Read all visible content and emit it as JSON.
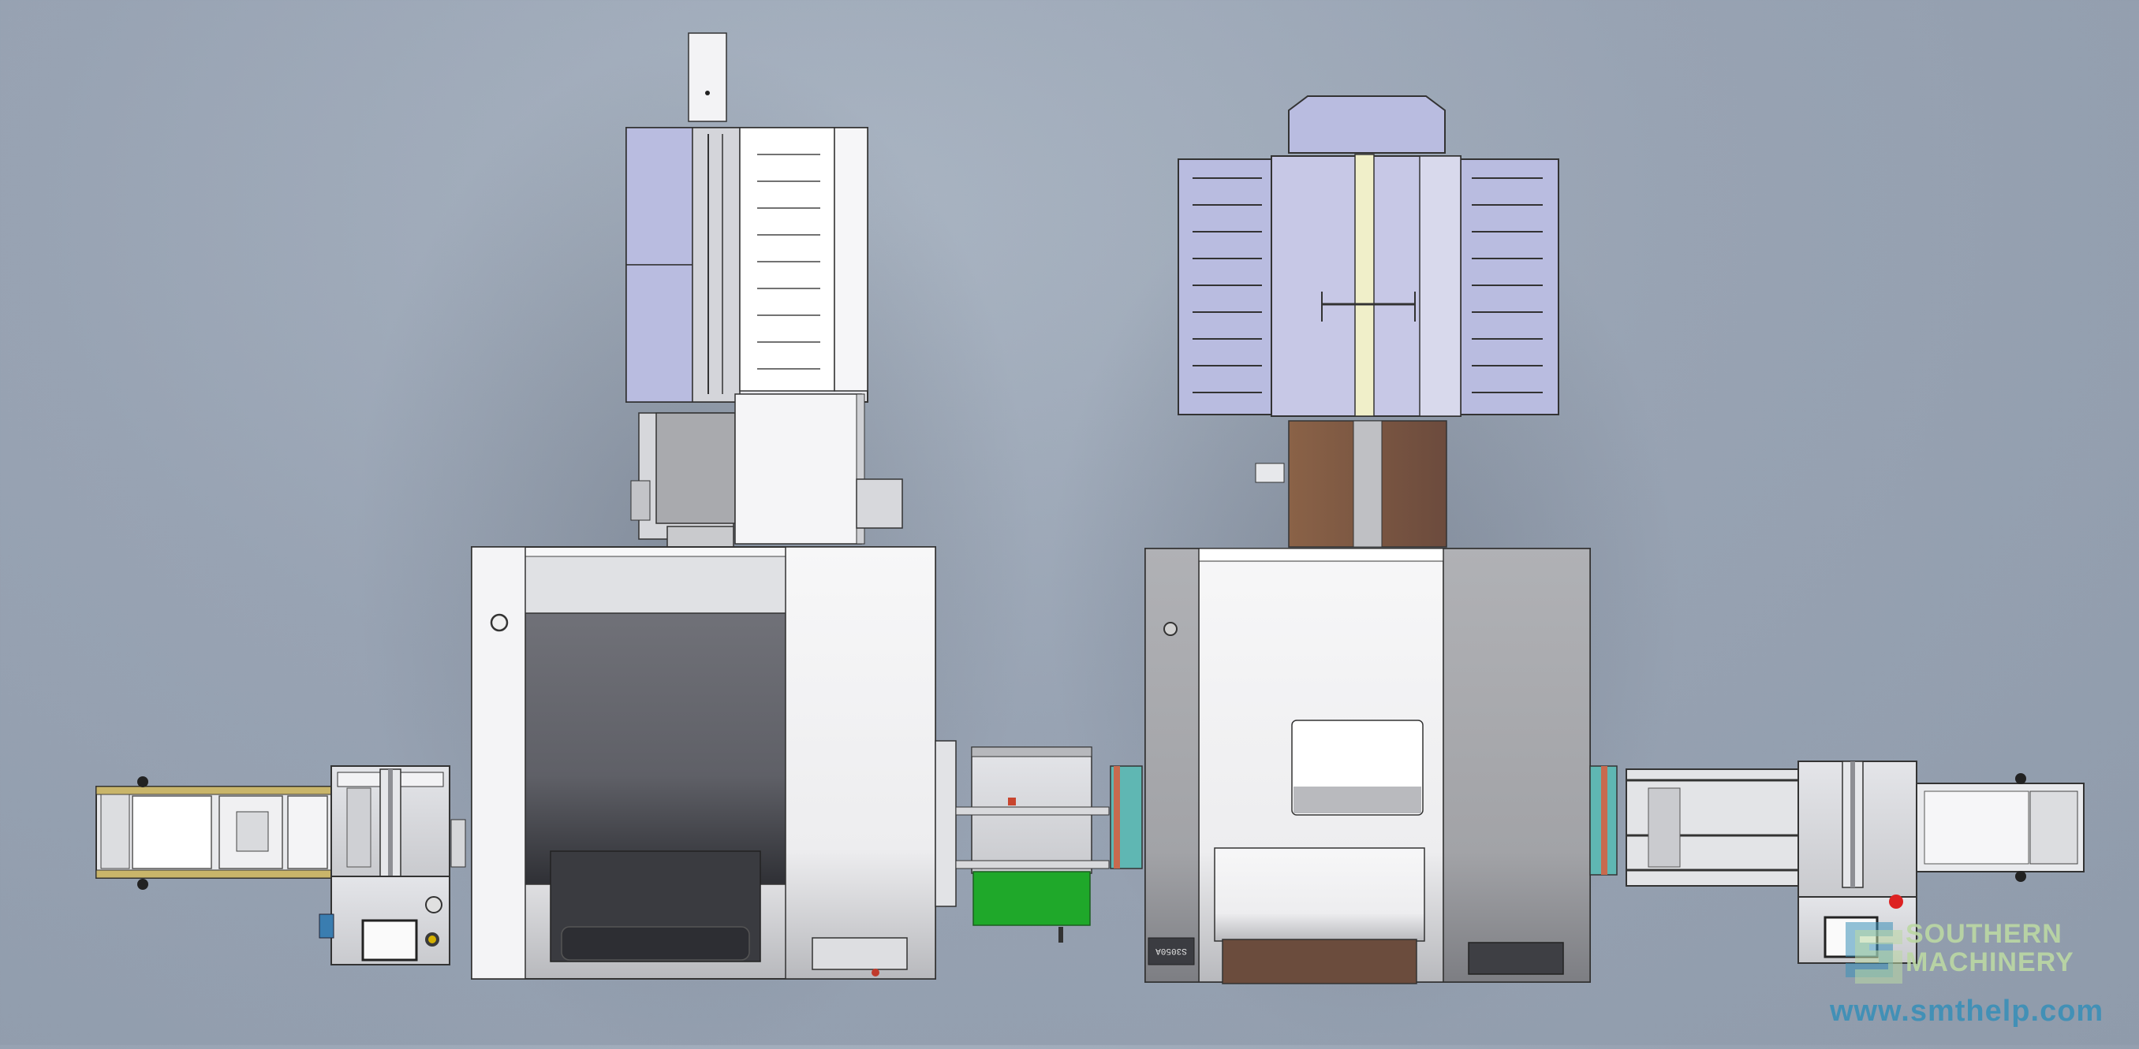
{
  "figure": {
    "model_plate_text": "S3050A"
  },
  "watermark": {
    "line1": "SOUTHERN",
    "line2": "MACHINERY",
    "url": "www.smthelp.com",
    "logo_icon": "sm-logo-icon"
  },
  "colors": {
    "background": "#98a3b3",
    "machine_white": "#f2f3f5",
    "machine_grey": "#a6a7ab",
    "magazine_lavender": "#b9bce0",
    "green_bin": "#1fa82a",
    "teal_panel": "#5fb7b3",
    "brown_panel": "#7a5a44",
    "watermark_green": "#bcd8a4",
    "watermark_blue": "#3a8fb8"
  }
}
